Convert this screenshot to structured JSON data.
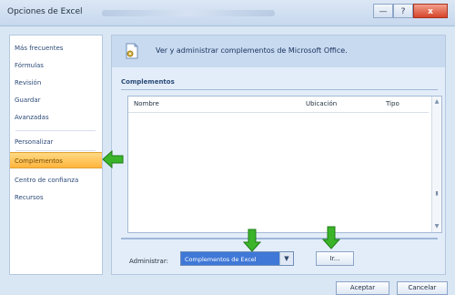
{
  "window": {
    "title": "Opciones de Excel",
    "buttons": {
      "minimize": "—",
      "maximize": "?",
      "close": "x"
    }
  },
  "sidebar": {
    "items": [
      {
        "label": "Más frecuentes"
      },
      {
        "label": "Fórmulas"
      },
      {
        "label": "Revisión"
      },
      {
        "label": "Guardar"
      },
      {
        "label": "Avanzadas"
      },
      {
        "label": "Personalizar"
      },
      {
        "label": "Complementos"
      },
      {
        "label": "Centro de confianza"
      },
      {
        "label": "Recursos"
      }
    ]
  },
  "main": {
    "header": "Ver y administrar complementos de Microsoft Office.",
    "section": "Complementos",
    "columns": [
      "Nombre",
      "Ubicación",
      "Tipo"
    ],
    "admin_label": "Administrar:",
    "manage_select": "Complementos de Excel",
    "go_button": "Ir...",
    "accept": "Aceptar",
    "cancel": "Cancelar"
  },
  "colors": {
    "active_item": "#ffb53d",
    "select_blue": "#3f78d7",
    "arrow_green": "#3bb42a"
  },
  "icons": {
    "header": "document-gear-icon",
    "dropdown": "chevron-down-icon",
    "pointer": "green-arrow-icon"
  }
}
